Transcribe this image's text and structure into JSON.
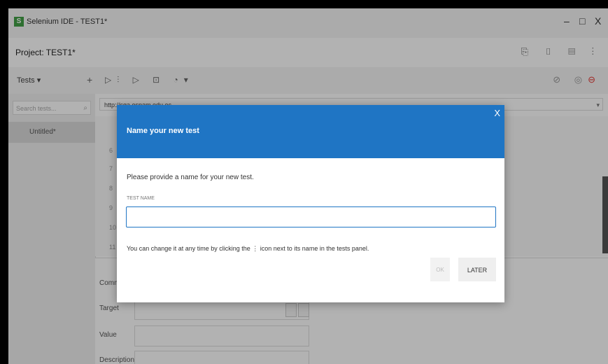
{
  "window": {
    "title": "Selenium IDE - TEST1*",
    "logo": "S",
    "minimize": "–",
    "maximize": "□",
    "close": "X"
  },
  "project": {
    "title": "Project: TEST1*",
    "icons": [
      "open-folder-icon",
      "save-icon",
      "document-icon",
      "more-icon"
    ],
    "icons_glyphs": "⎘ ▯ ▤ ⋮"
  },
  "toolbar": {
    "tests_label": "Tests ▾",
    "add_label": "+",
    "play_tools": "▷⫶ ▷ ⊡ ◔▾",
    "right_tools": "⊘ ◎",
    "record": "⊖"
  },
  "sidebar": {
    "search_placeholder": "Search tests...",
    "search_icon": "⌕",
    "items": [
      {
        "label": "Untitled*"
      }
    ]
  },
  "url": {
    "value": "http://sga.espam.edu.ec",
    "chevron": "▾"
  },
  "editor": {
    "line_numbers": [
      "6",
      "7",
      "8",
      "9",
      "10",
      "11"
    ],
    "fields": [
      "Command",
      "Target",
      "Value",
      "Description"
    ]
  },
  "dialog": {
    "title": "Name your new test",
    "close": "X",
    "description": "Please provide a name for your new test.",
    "field_label": "TEST NAME",
    "field_value": "",
    "hint": "You can change it at any time by clicking the  ⋮  icon next to its name in the tests panel.",
    "ok_label": "OK",
    "later_label": "LATER"
  },
  "colors": {
    "dialog_header": "#1f75c4",
    "record_red": "#e53935"
  }
}
